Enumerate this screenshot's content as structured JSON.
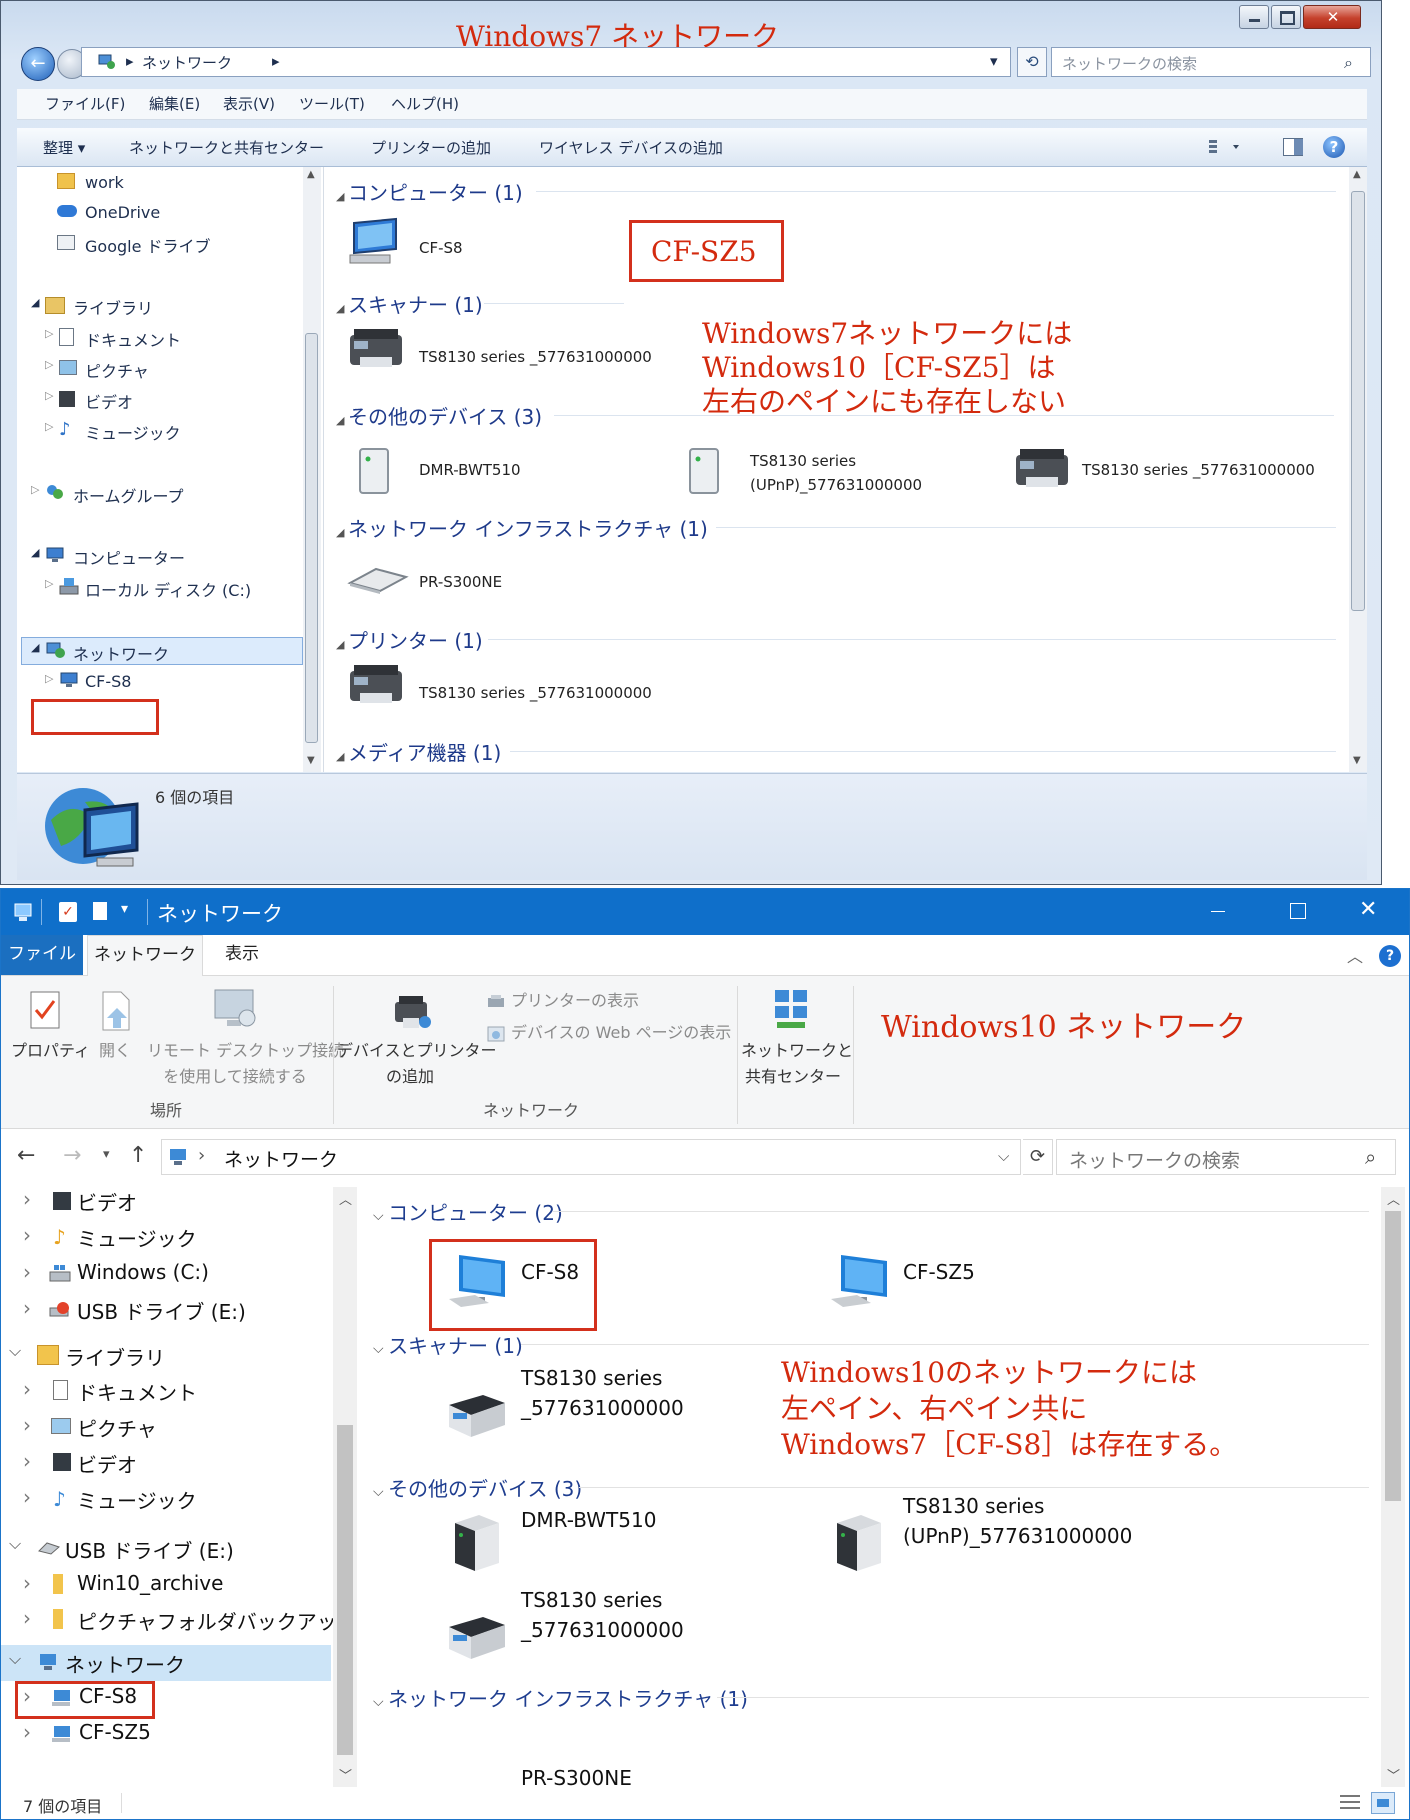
{
  "win7": {
    "caption": "Windows7 ネットワーク",
    "breadcrumb": "ネットワーク",
    "search_placeholder": "ネットワークの検索",
    "menu": [
      "ファイル(F)",
      "編集(E)",
      "表示(V)",
      "ツール(T)",
      "ヘルプ(H)"
    ],
    "commands": [
      "整理 ▾",
      "ネットワークと共有センター",
      "プリンターの追加",
      "ワイヤレス デバイスの追加"
    ],
    "nav": {
      "work": "work",
      "onedrive": "OneDrive",
      "gdrive": "Google ドライブ",
      "library": "ライブラリ",
      "documents": "ドキュメント",
      "pictures": "ピクチャ",
      "videos": "ビデオ",
      "music": "ミュージック",
      "homegroup": "ホームグループ",
      "computer": "コンピューター",
      "localdisk": "ローカル ディスク (C:)",
      "network": "ネットワーク",
      "cfs8": "CF-S8"
    },
    "groups": {
      "computer": "コンピューター (1)",
      "scanner": "スキャナー (1)",
      "other": "その他のデバイス (3)",
      "infra": "ネットワーク インフラストラクチャ (1)",
      "printer": "プリンター (1)",
      "media": "メディア機器 (1)"
    },
    "items": {
      "cfs8": "CF-S8",
      "scanner1": "TS8130 series _577631000000",
      "dmr": "DMR-BWT510",
      "upnp_line1": "TS8130 series",
      "upnp_line2": "(UPnP)_577631000000",
      "ts_other": "TS8130 series _577631000000",
      "router": "PR-S300NE",
      "printer1": "TS8130 series _577631000000"
    },
    "status": "6 個の項目",
    "annotation_box": "CF-SZ5",
    "annotation": [
      "Windows7ネットワークには",
      "Windows10［CF-SZ5］は",
      "左右のペインにも存在しない"
    ]
  },
  "win10": {
    "title": "ネットワーク",
    "tabs": [
      "ファイル",
      "ネットワーク",
      "表示"
    ],
    "ribbon": {
      "properties": "プロパティ",
      "open": "開く",
      "remote1": "リモート デスクトップ接続",
      "remote2": "を使用して接続する",
      "group_location": "場所",
      "add1": "デバイスとプリンター",
      "add2": "の追加",
      "show_printers": "プリンターの表示",
      "show_web": "デバイスの Web ページの表示",
      "group_network": "ネットワーク",
      "center1": "ネットワークと",
      "center2": "共有センター"
    },
    "caption": "Windows10 ネットワーク",
    "breadcrumb": "ネットワーク",
    "search_placeholder": "ネットワークの検索",
    "nav": {
      "videos": "ビデオ",
      "music": "ミュージック",
      "windows_c": "Windows (C:)",
      "usb1": "USB ドライブ (E:)",
      "library": "ライブラリ",
      "documents": "ドキュメント",
      "pictures": "ピクチャ",
      "videos2": "ビデオ",
      "music2": "ミュージック",
      "usb2": "USB ドライブ (E:)",
      "win10archive": "Win10_archive",
      "picbackup": "ピクチャフォルダバックアップ",
      "network": "ネットワーク",
      "cfs8": "CF-S8",
      "cfsz5": "CF-SZ5"
    },
    "groups": {
      "computer": "コンピューター (2)",
      "scanner": "スキャナー (1)",
      "other": "その他のデバイス (3)",
      "infra": "ネットワーク インフラストラクチャ (1)"
    },
    "items": {
      "cfs8": "CF-S8",
      "cfsz5": "CF-SZ5",
      "scanner_l1": "TS8130 series",
      "scanner_l2": "_577631000000",
      "dmr": "DMR-BWT510",
      "upnp_l1": "TS8130 series",
      "upnp_l2": "(UPnP)_577631000000",
      "ts_l1": "TS8130 series",
      "ts_l2": "_577631000000",
      "router": "PR-S300NE"
    },
    "annotation": [
      "Windows10のネットワークには",
      "左ペイン、右ペイン共に",
      "Windows7［CF-S8］は存在する。"
    ],
    "status": "7 個の項目"
  },
  "colors": {
    "annotation": "#d32a0e",
    "w10_titlebar": "#0f6fca",
    "w7_group": "#1e3a8a"
  }
}
